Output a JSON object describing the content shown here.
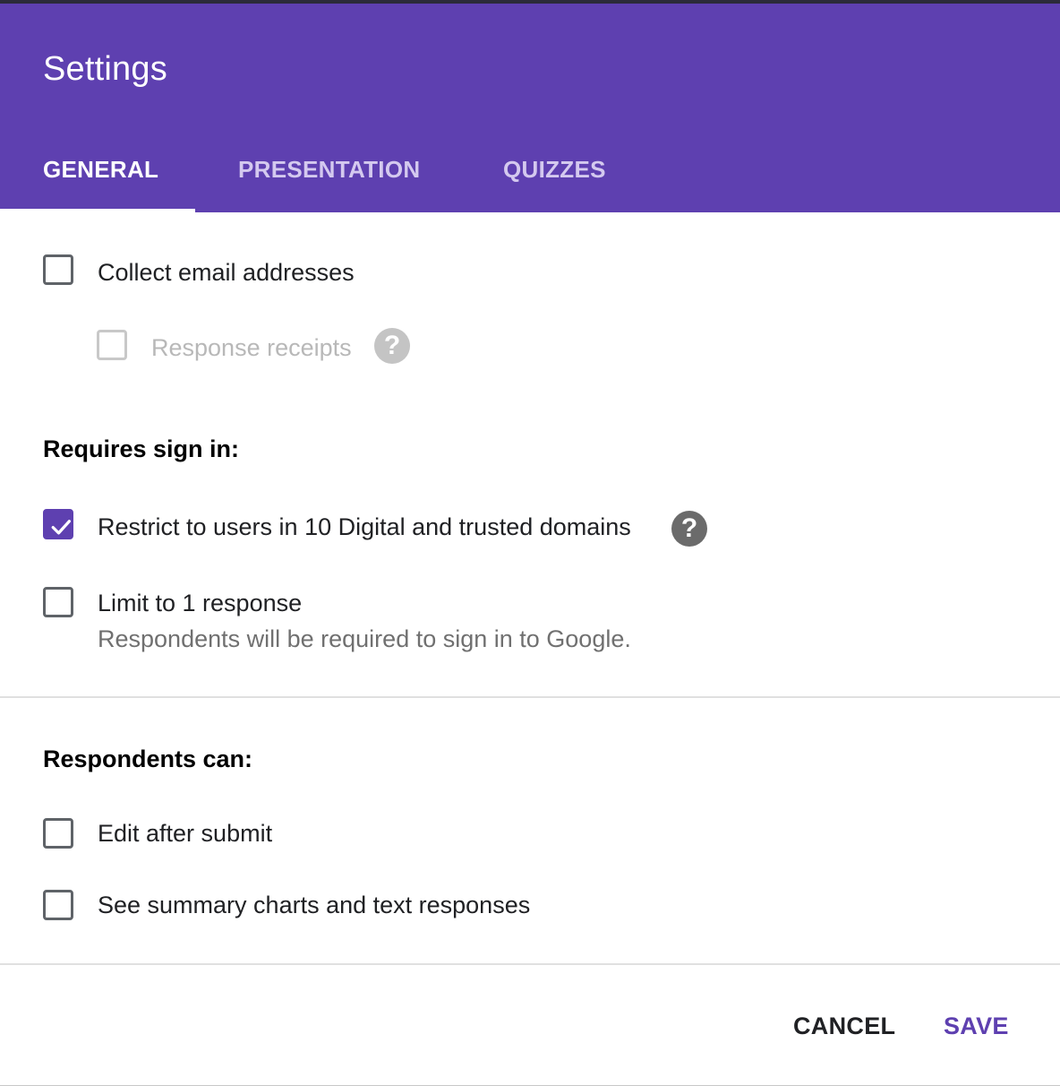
{
  "dialog": {
    "title": "Settings",
    "tabs": [
      {
        "label": "GENERAL",
        "active": true
      },
      {
        "label": "PRESENTATION",
        "active": false
      },
      {
        "label": "QUIZZES",
        "active": false
      }
    ]
  },
  "options": {
    "collect_email": {
      "label": "Collect email addresses",
      "checked": false
    },
    "response_receipts": {
      "label": "Response receipts",
      "checked": false,
      "disabled": true,
      "help_icon": "?"
    },
    "sign_in": {
      "heading": "Requires sign in:",
      "restrict": {
        "label": "Restrict to users in 10 Digital and trusted domains",
        "checked": true,
        "help_icon": "?"
      },
      "limit": {
        "label": "Limit to 1 response",
        "checked": false,
        "subtext": "Respondents will be required to sign in to Google."
      }
    },
    "respondents": {
      "heading": "Respondents can:",
      "edit": {
        "label": "Edit after submit",
        "checked": false
      },
      "summary": {
        "label": "See summary charts and text responses",
        "checked": false
      }
    }
  },
  "actions": {
    "cancel_label": "CANCEL",
    "save_label": "SAVE"
  },
  "colors": {
    "accent": "#5e40b0",
    "header_bg": "#5e40b0"
  }
}
